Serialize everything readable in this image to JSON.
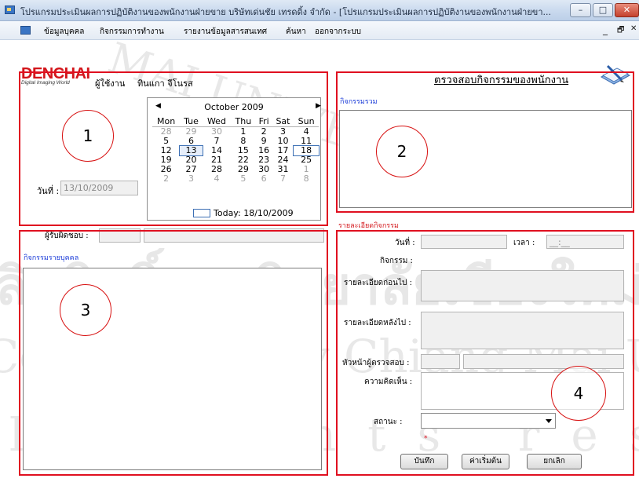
{
  "window": {
    "title": "โปรแกรมประเมินผลการปฏิบัติงานของพนักงานฝ่ายขาย บริษัทเด่นชัย เทรดดิ้ง จำกัด - [โปรแกรมประเมินผลการปฏิบัติงานของพนักงานฝ่ายขา...",
    "buttons": {
      "minimize": "–",
      "maximize": "□",
      "close": "✕"
    }
  },
  "menu": {
    "items": [
      "ข้อมูลบุคคล",
      "กิจกรรมการทำงาน",
      "รายงานข้อมูลสารสนเทศ",
      "ค้นหา",
      "ออกจากระบบ"
    ],
    "mdi_minimize": "_",
    "mdi_restore": "🗗",
    "mdi_close": "✕"
  },
  "logo": {
    "name": "DENCHAI",
    "tagline": "Digital Imaging World"
  },
  "user": {
    "label": "ผู้ใช้งาน",
    "name": "ทินแกา จีโนรส"
  },
  "date": {
    "label": "วันที่ :",
    "value": "13/10/2009"
  },
  "calendar": {
    "month_title": "October 2009",
    "prev": "◀",
    "next": "▶",
    "weekdays": [
      "Mon",
      "Tue",
      "Wed",
      "Thu",
      "Fri",
      "Sat",
      "Sun"
    ],
    "weeks": [
      [
        "28",
        "29",
        "30",
        "1",
        "2",
        "3",
        "4"
      ],
      [
        "5",
        "6",
        "7",
        "8",
        "9",
        "10",
        "11"
      ],
      [
        "12",
        "13",
        "14",
        "15",
        "16",
        "17",
        "18"
      ],
      [
        "19",
        "20",
        "21",
        "22",
        "23",
        "24",
        "25"
      ],
      [
        "26",
        "27",
        "28",
        "29",
        "30",
        "31",
        "1"
      ],
      [
        "2",
        "3",
        "4",
        "5",
        "6",
        "7",
        "8"
      ]
    ],
    "selected_day": "13",
    "today_text": "Today: 18/10/2009"
  },
  "page_title": "ตรวจสอบกิจกรรมของพนักงาน",
  "all_activities": {
    "label": "กิจกรรมรวม"
  },
  "responsible": {
    "label": "ผู้รับผิดชอบ :"
  },
  "personal_activities": {
    "label": "กิจกรรมรายบุคคล"
  },
  "details": {
    "header": "รายละเอียดกิจกรรม",
    "date_label": "วันที่ :",
    "time_label": "เวลา :",
    "time_value": "__:__",
    "activity_label": "กิจกรรม :",
    "before_label": "รายละเอียดก่อนไป :",
    "after_label": "รายละเอียดหลังไป :",
    "supervisor_label": "หัวหน้าผู้ตรวจสอบ :",
    "comment_label": "ความคิดเห็น :",
    "status_label": "สถานะ :",
    "required_mark": "*"
  },
  "buttons": {
    "save": "บันทึก",
    "reset": "ค่าเริ่มต้น",
    "cancel": "ยกเลิก"
  },
  "annotations": {
    "c1": "1",
    "c2": "2",
    "c3": "3",
    "c4": "4"
  },
  "watermark": {
    "line1": "MAI UNIVERSITY",
    "line2": "ลิขสิทธิ์มหาวิทยาลัยเชียงใหม่",
    "line3": "Copyright© by Chiang Mai University",
    "line4": "All rights reserved"
  },
  "colors": {
    "annotation_red": "#e01020",
    "section_blue": "#1a3bd8",
    "logo_red": "#d3161b"
  }
}
